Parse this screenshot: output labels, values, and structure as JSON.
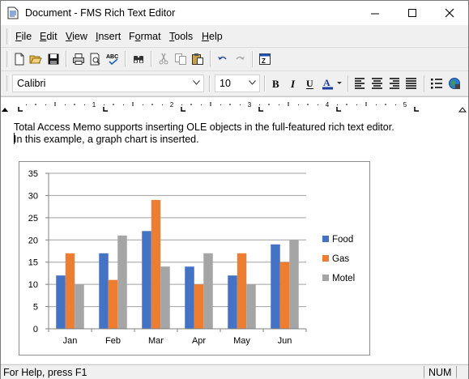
{
  "window": {
    "title": "Document - FMS Rich Text Editor"
  },
  "menu": [
    {
      "label": "File",
      "mnemonic": "F",
      "rest": "ile"
    },
    {
      "label": "Edit",
      "mnemonic": "E",
      "rest": "dit"
    },
    {
      "label": "View",
      "mnemonic": "V",
      "rest": "iew"
    },
    {
      "label": "Insert",
      "mnemonic": "I",
      "rest": "nsert"
    },
    {
      "label": "Format",
      "mnemonic": "o",
      "pre": "F",
      "rest": "rmat"
    },
    {
      "label": "Tools",
      "mnemonic": "T",
      "rest": "ools"
    },
    {
      "label": "Help",
      "mnemonic": "H",
      "rest": "elp"
    }
  ],
  "toolbar": {
    "icons": [
      "new-document-icon",
      "open-folder-icon",
      "save-icon",
      "print-icon",
      "print-preview-icon",
      "spell-check-icon",
      "find-icon",
      "cut-icon",
      "copy-icon",
      "paste-icon",
      "undo-icon",
      "redo-icon",
      "insert-object-icon"
    ]
  },
  "format": {
    "font": "Calibri",
    "size": "10",
    "icons": [
      "bold-icon",
      "italic-icon",
      "underline-icon",
      "font-color-icon",
      "align-left-icon",
      "align-center-icon",
      "align-right-icon",
      "justify-icon",
      "bullets-icon",
      "web-icon"
    ]
  },
  "ruler": {
    "numbers": [
      "1",
      "2",
      "3",
      "4",
      "5"
    ]
  },
  "document": {
    "line1": "Total Access Memo supports inserting OLE objects in the full-featured rich text editor.",
    "line2": "In this example, a graph chart is inserted."
  },
  "chart_data": {
    "type": "bar",
    "categories": [
      "Jan",
      "Feb",
      "Mar",
      "Apr",
      "May",
      "Jun"
    ],
    "series": [
      {
        "name": "Food",
        "color": "#4472c4",
        "values": [
          12,
          17,
          22,
          14,
          12,
          19
        ]
      },
      {
        "name": "Gas",
        "color": "#ed7d31",
        "values": [
          17,
          11,
          29,
          10,
          17,
          15
        ]
      },
      {
        "name": "Motel",
        "color": "#a5a5a5",
        "values": [
          10,
          21,
          14,
          17,
          10,
          20
        ]
      }
    ],
    "ylim": [
      0,
      35
    ],
    "yticks": [
      "0",
      "5",
      "10",
      "15",
      "20",
      "25",
      "30",
      "35"
    ],
    "grid": true,
    "legend": "right"
  },
  "status": {
    "help": "For Help, press F1",
    "num": "NUM"
  }
}
